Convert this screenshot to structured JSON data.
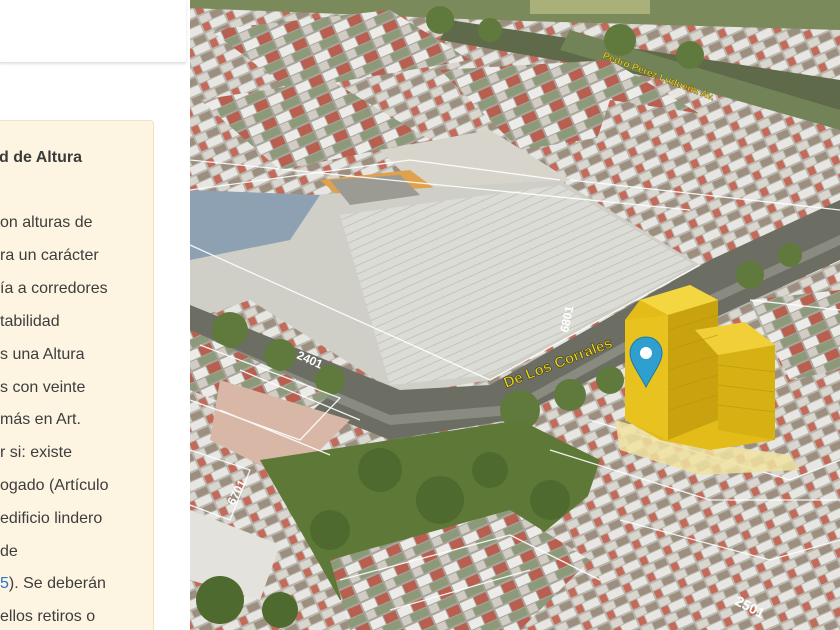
{
  "sidebar": {
    "section_title": "d de Altura",
    "lines": [
      "on alturas de",
      "ra un carácter",
      "ía a corredores",
      "tabilidad",
      "s una Altura",
      "s con veinte",
      "más en Art.",
      "r si: existe",
      "ogado (Artículo",
      "edificio lindero",
      "de"
    ],
    "last_line_link": "5",
    "last_line_text": "). Se deberán",
    "final_line": "ellos retiros o"
  },
  "map": {
    "street_name": "De Los Corrales",
    "street_top": "Pedro Pérez Ludueña Av.",
    "numbers": {
      "n2401": "2401",
      "n6801": "6801",
      "n6701": "6701",
      "n2501": "2501"
    },
    "colors": {
      "highlight_building": "#e3bc1a",
      "marker": "#2f9fd0",
      "street_label": "#e9d21c"
    },
    "marker_icon": "map-pin-icon"
  }
}
